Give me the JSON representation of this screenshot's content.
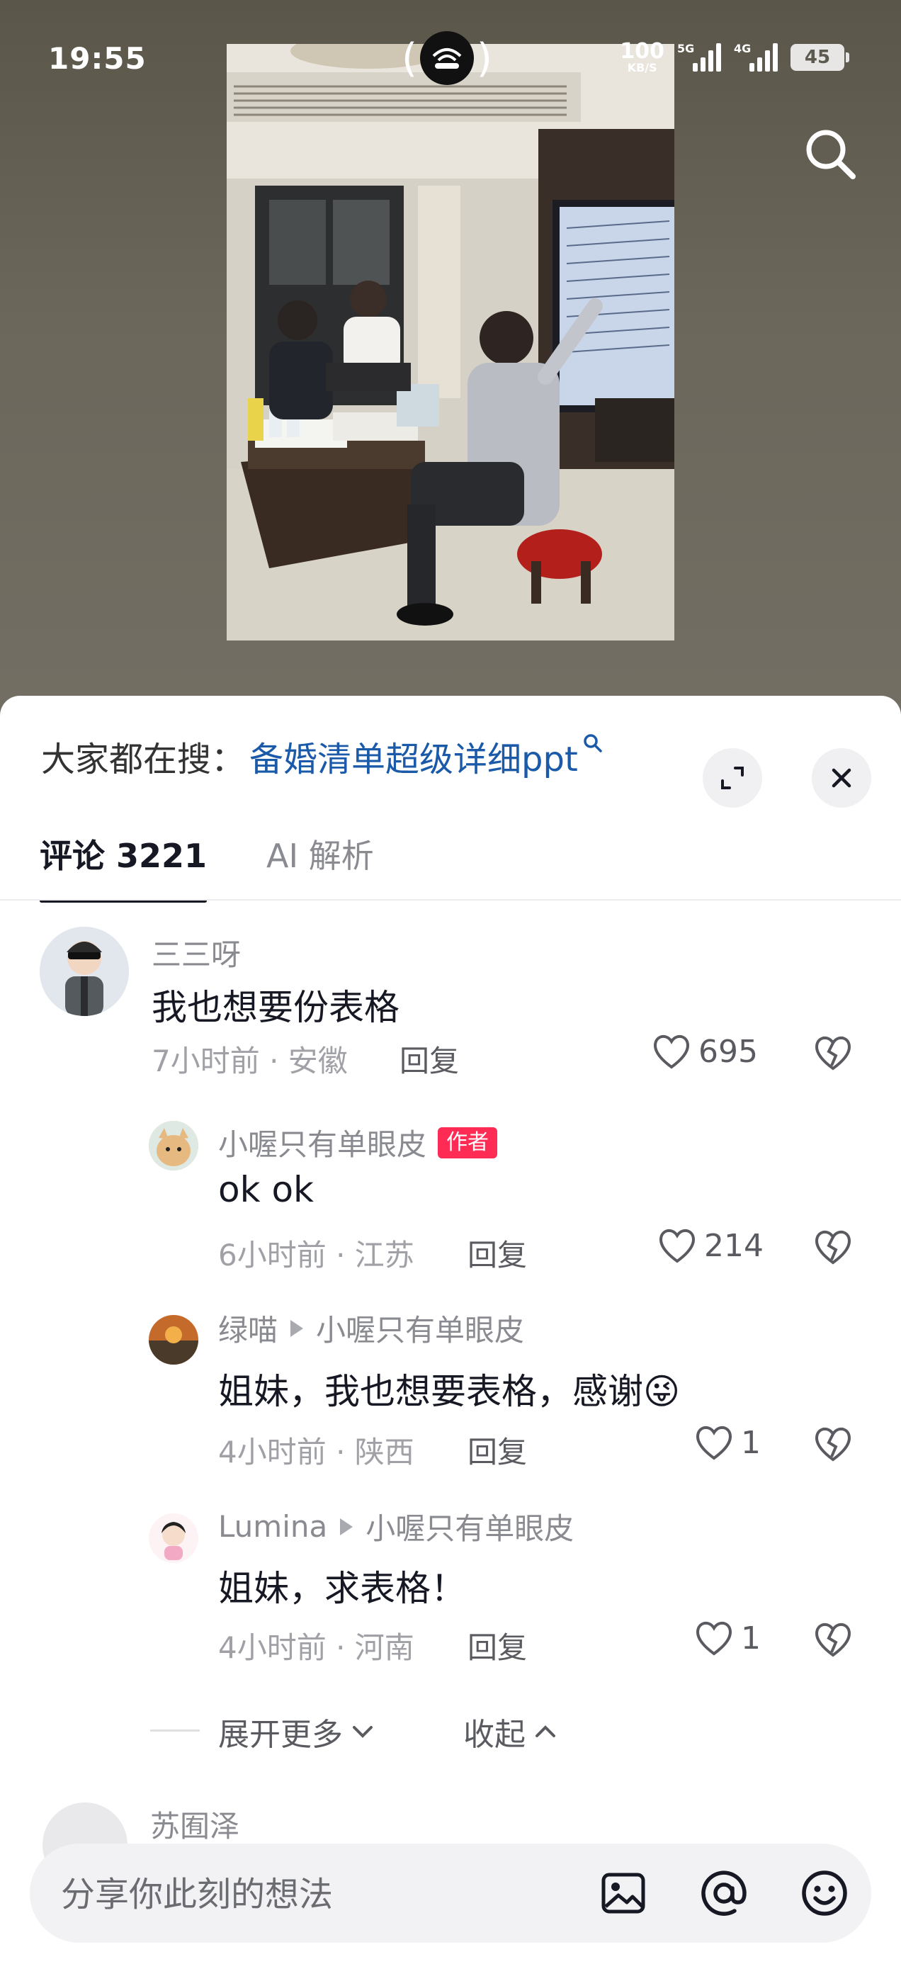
{
  "status_bar": {
    "time": "19:55",
    "net_speed_value": "100",
    "net_speed_unit": "KB/S",
    "signal_1_label": "5G",
    "signal_2_label": "4G",
    "battery": "45"
  },
  "sheet": {
    "search_prefix": "大家都在搜：",
    "search_keyword": "备婚清单超级详细ppt",
    "tabs": [
      {
        "label": "评论 3221",
        "active": true
      },
      {
        "label": "AI 解析",
        "active": false
      }
    ]
  },
  "comments": [
    {
      "author": "三三呀",
      "text": "我也想要份表格",
      "time_location": "7小时前 · 安徽",
      "reply": "回复",
      "likes": "695"
    },
    {
      "author": "小喔只有单眼皮",
      "badge": "作者",
      "text": "ok ok",
      "time_location": "6小时前 · 江苏",
      "reply": "回复",
      "likes": "214"
    },
    {
      "author": "绿喵",
      "reply_to": "小喔只有单眼皮",
      "text": "姐妹，我也想要表格，感谢",
      "emoji": "😜",
      "time_location": "4小时前 · 陕西",
      "reply": "回复",
      "likes": "1"
    },
    {
      "author": "Lumina",
      "reply_to": "小喔只有单眼皮",
      "text": "姐妹，求表格！",
      "time_location": "4小时前 · 河南",
      "reply": "回复",
      "likes": "1"
    }
  ],
  "thread_controls": {
    "expand": "展开更多",
    "collapse": "收起"
  },
  "next_comment_author": "苏囿泽",
  "input": {
    "placeholder": "分享你此刻的想法"
  },
  "icons": {
    "search": "search-icon",
    "expand": "expand-icon",
    "close": "close-icon",
    "like": "heart-icon",
    "dislike": "broken-heart-icon",
    "image": "image-icon",
    "mention": "at-icon",
    "emoji": "emoji-icon"
  },
  "colors": {
    "accent_red": "#fe2c55",
    "keyword_blue": "#1b5aa8"
  }
}
